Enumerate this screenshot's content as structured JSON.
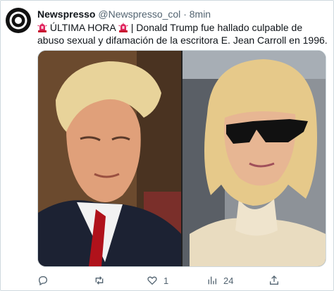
{
  "tweet": {
    "author_name": "Newspresso",
    "author_handle": "@Newspresso_col",
    "separator": "·",
    "time": "8min",
    "alert_label": "ÚLTIMA HORA",
    "body": "| Donald Trump fue hallado culpable de abuso sexual y difamación de la escritora E. Jean Carroll en 1996."
  },
  "actions": {
    "reply_count": "",
    "retweet_count": "",
    "like_count": "1",
    "views_count": "24"
  },
  "colors": {
    "text": "#0f1419",
    "muted": "#536471",
    "border": "#cfd9de",
    "alert_red": "#e0245e"
  },
  "icons": [
    "newspresso-logo",
    "siren-icon",
    "reply-icon",
    "retweet-icon",
    "like-icon",
    "views-icon",
    "share-icon"
  ]
}
